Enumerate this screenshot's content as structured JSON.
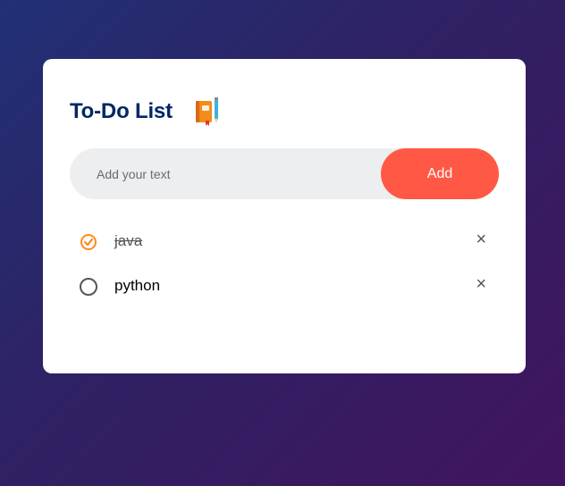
{
  "app": {
    "title": "To-Do List",
    "icon": "notebook-pencil-icon"
  },
  "input": {
    "placeholder": "Add your text",
    "value": ""
  },
  "add_button": {
    "label": "Add"
  },
  "tasks": [
    {
      "text": "java",
      "checked": true
    },
    {
      "text": "python",
      "checked": false
    }
  ],
  "remove_glyph": "×",
  "colors": {
    "title": "#002765",
    "accent": "#ff5945",
    "check": "#ff5945",
    "input_bg": "#edeef0"
  }
}
